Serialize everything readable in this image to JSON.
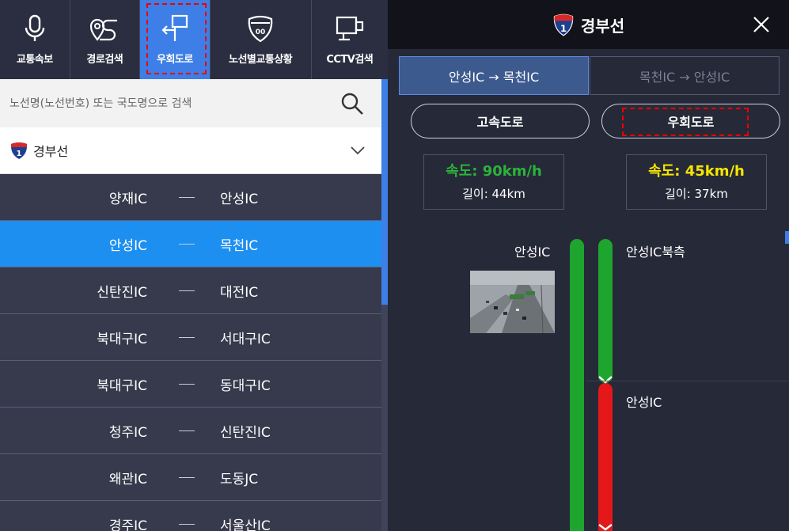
{
  "nav": {
    "items": [
      {
        "label": "교통속보",
        "icon": "microphone-icon"
      },
      {
        "label": "경로검색",
        "icon": "route-pin-icon"
      },
      {
        "label": "우회도로",
        "icon": "detour-sign-icon"
      },
      {
        "label": "노선별교통상황",
        "icon": "highway-shield-icon",
        "badge": "00"
      },
      {
        "label": "CCTV검색",
        "icon": "cctv-monitor-icon"
      }
    ]
  },
  "search": {
    "placeholder": "노선명(노선번호) 또는 국도명으로 검색"
  },
  "route_select": {
    "shield_number": "1",
    "name": "경부선"
  },
  "segments": [
    {
      "from": "양재IC",
      "to": "안성IC"
    },
    {
      "from": "안성IC",
      "to": "목천IC"
    },
    {
      "from": "신탄진IC",
      "to": "대전IC"
    },
    {
      "from": "북대구IC",
      "to": "서대구IC"
    },
    {
      "from": "북대구IC",
      "to": "동대구IC"
    },
    {
      "from": "청주IC",
      "to": "신탄진IC"
    },
    {
      "from": "왜관IC",
      "to": "도동JC"
    },
    {
      "from": "경주IC",
      "to": "서울산IC"
    }
  ],
  "detail": {
    "shield_number": "1",
    "title": "경부선",
    "direction_tabs": [
      "안성IC → 목천IC",
      "목천IC → 안성IC"
    ],
    "road_types": [
      "고속도로",
      "우회도로"
    ],
    "highway": {
      "speed": "속도: 90km/h",
      "length": "길이: 44km"
    },
    "detour": {
      "speed": "속도: 45km/h",
      "length": "길이: 37km"
    },
    "left_node": "안성IC",
    "right_nodes": [
      "안성IC북측",
      "안성IC"
    ]
  },
  "colors": {
    "accent": "#3d7fe6",
    "selected_row": "#1d8ff0",
    "speed_green": "#1ea52e",
    "speed_red": "#e41818",
    "speed_yellow_text": "#f5e600",
    "speed_green_text": "#2bb33a"
  }
}
